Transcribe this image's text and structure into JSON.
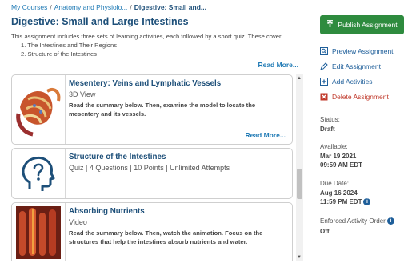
{
  "breadcrumb": {
    "courses": "My Courses",
    "anatomy": "Anatomy and Physiolo...",
    "current": "Digestive: Small and..."
  },
  "assignment": {
    "title": "Digestive: Small and Large Intestines",
    "description": "This assignment includes three sets of learning activities, each followed by a short quiz. These cover:",
    "topics": [
      "1. The Intestines and Their Regions",
      "2. Structure of the Intestines"
    ],
    "read_more": "Read More..."
  },
  "activities": [
    {
      "title": "Mesentery: Veins and Lymphatic Vessels",
      "type": "3D View",
      "summary": "Read the summary below. Then, examine the model to locate the mesentery and its vessels.",
      "read_more": "Read More...",
      "icon": "mesentery-model-image"
    },
    {
      "title": "Structure of the Intestines",
      "type": "Quiz | 4 Questions | 10 Points | Unlimited Attempts",
      "icon": "head-question-icon"
    },
    {
      "title": "Absorbing Nutrients",
      "type": "Video",
      "summary": "Read the summary below. Then, watch the animation. Focus on the structures that help the intestines absorb nutrients and water.",
      "icon": "intestinal-villi-image"
    }
  ],
  "sidebar": {
    "publish_label": "Publish Assignment",
    "actions": {
      "preview": "Preview Assignment",
      "edit": "Edit Assignment",
      "add": "Add Activities",
      "delete": "Delete Assignment"
    },
    "status_label": "Status:",
    "status_value": "Draft",
    "available_label": "Available:",
    "available_date": "Mar 19 2021",
    "available_time": "09:59 AM EDT",
    "due_label": "Due Date:",
    "due_date": "Aug 16 2024",
    "due_time": "11:59 PM EDT",
    "order_label": "Enforced Activity Order",
    "order_value": "Off"
  },
  "colors": {
    "link": "#1f7ab5",
    "title": "#1d4f79",
    "publish": "#2e8b3e",
    "delete": "#c0392b"
  }
}
